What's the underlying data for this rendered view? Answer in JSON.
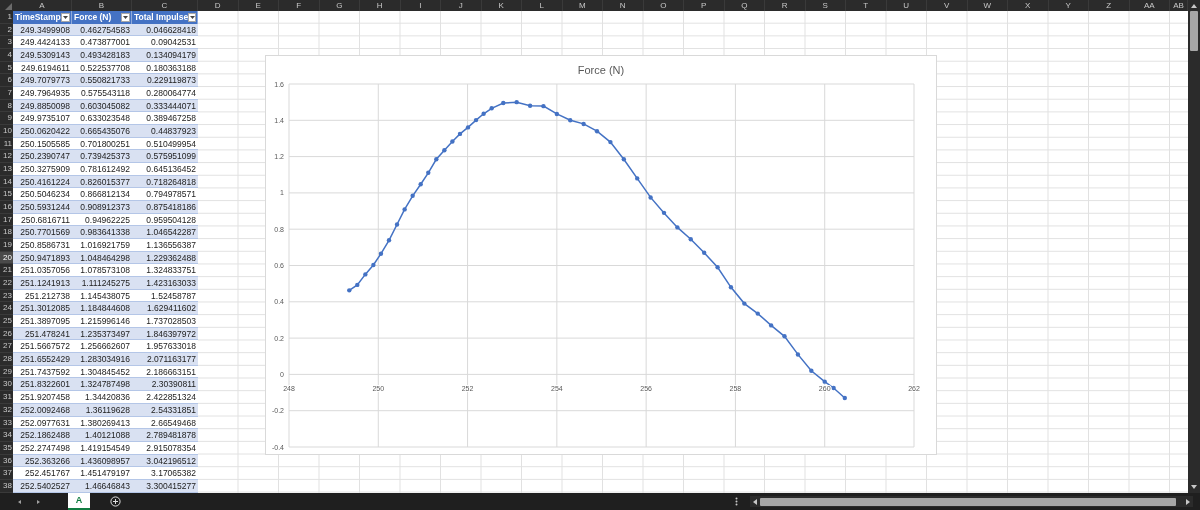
{
  "column_headers": [
    "A",
    "B",
    "C",
    "D",
    "E",
    "F",
    "G",
    "H",
    "I",
    "J",
    "K",
    "L",
    "M",
    "N",
    "O",
    "P",
    "Q",
    "R",
    "S",
    "T",
    "U",
    "V",
    "W",
    "X",
    "Y",
    "Z",
    "AA",
    "AB"
  ],
  "row_headers": [
    {
      "label": "1",
      "selected": false
    },
    {
      "label": "2",
      "selected": false
    },
    {
      "label": "3",
      "selected": false
    },
    {
      "label": "4",
      "selected": false
    },
    {
      "label": "5",
      "selected": false
    },
    {
      "label": "6",
      "selected": false
    },
    {
      "label": "7",
      "selected": false
    },
    {
      "label": "8",
      "selected": false
    },
    {
      "label": "9",
      "selected": false
    },
    {
      "label": "10",
      "selected": false
    },
    {
      "label": "11",
      "selected": false
    },
    {
      "label": "12",
      "selected": false
    },
    {
      "label": "13",
      "selected": false
    },
    {
      "label": "14",
      "selected": false
    },
    {
      "label": "15",
      "selected": false
    },
    {
      "label": "16",
      "selected": false
    },
    {
      "label": "17",
      "selected": false
    },
    {
      "label": "18",
      "selected": false
    },
    {
      "label": "19",
      "selected": false
    },
    {
      "label": "20",
      "selected": true
    },
    {
      "label": "21",
      "selected": false
    },
    {
      "label": "22",
      "selected": false
    },
    {
      "label": "23",
      "selected": false
    },
    {
      "label": "24",
      "selected": false
    },
    {
      "label": "25",
      "selected": false
    },
    {
      "label": "26",
      "selected": false
    },
    {
      "label": "27",
      "selected": false
    },
    {
      "label": "28",
      "selected": false
    },
    {
      "label": "29",
      "selected": false
    },
    {
      "label": "30",
      "selected": false
    },
    {
      "label": "31",
      "selected": false
    },
    {
      "label": "32",
      "selected": false
    },
    {
      "label": "33",
      "selected": false
    },
    {
      "label": "34",
      "selected": false
    },
    {
      "label": "35",
      "selected": false
    },
    {
      "label": "36",
      "selected": false
    },
    {
      "label": "37",
      "selected": false
    },
    {
      "label": "38",
      "selected": false
    }
  ],
  "table": {
    "columns": [
      "TimeStamp",
      "Force (N)",
      "Total Impulse"
    ],
    "rows": [
      [
        "249.3499908",
        "0.462754583",
        "0.046628418"
      ],
      [
        "249.4424133",
        "0.473877001",
        "0.09042531"
      ],
      [
        "249.5309143",
        "0.493428183",
        "0.134094179"
      ],
      [
        "249.6194611",
        "0.522537708",
        "0.180363188"
      ],
      [
        "249.7079773",
        "0.550821733",
        "0.229119873"
      ],
      [
        "249.7964935",
        "0.575543118",
        "0.280064774"
      ],
      [
        "249.8850098",
        "0.603045082",
        "0.333444071"
      ],
      [
        "249.9735107",
        "0.633023548",
        "0.389467258"
      ],
      [
        "250.0620422",
        "0.665435076",
        "0.44837923"
      ],
      [
        "250.1505585",
        "0.701800251",
        "0.510499954"
      ],
      [
        "250.2390747",
        "0.739425373",
        "0.575951099"
      ],
      [
        "250.3275909",
        "0.781612492",
        "0.645136452"
      ],
      [
        "250.4161224",
        "0.826015377",
        "0.718264818"
      ],
      [
        "250.5046234",
        "0.866812134",
        "0.794978571"
      ],
      [
        "250.5931244",
        "0.908912373",
        "0.875418186"
      ],
      [
        "250.6816711",
        "0.94962225",
        "0.959504128"
      ],
      [
        "250.7701569",
        "0.983641338",
        "1.046542287"
      ],
      [
        "250.8586731",
        "1.016921759",
        "1.136556387"
      ],
      [
        "250.9471893",
        "1.048464298",
        "1.229362488"
      ],
      [
        "251.0357056",
        "1.078573108",
        "1.324833751"
      ],
      [
        "251.1241913",
        "1.111245275",
        "1.423163033"
      ],
      [
        "251.212738",
        "1.145438075",
        "1.52458787"
      ],
      [
        "251.3012085",
        "1.184844608",
        "1.629411602"
      ],
      [
        "251.3897095",
        "1.215996146",
        "1.737028503"
      ],
      [
        "251.478241",
        "1.235373497",
        "1.846397972"
      ],
      [
        "251.5667572",
        "1.256662607",
        "1.957633018"
      ],
      [
        "251.6552429",
        "1.283034916",
        "2.071163177"
      ],
      [
        "251.7437592",
        "1.304845452",
        "2.186663151"
      ],
      [
        "251.8322601",
        "1.324787498",
        "2.30390811"
      ],
      [
        "251.9207458",
        "1.34420836",
        "2.422851324"
      ],
      [
        "252.0092468",
        "1.36119628",
        "2.54331851"
      ],
      [
        "252.0977631",
        "1.380269413",
        "2.66549468"
      ],
      [
        "252.1862488",
        "1.40121088",
        "2.789481878"
      ],
      [
        "252.2747498",
        "1.419154549",
        "2.915078354"
      ],
      [
        "252.363266",
        "1.436098957",
        "3.042196512"
      ],
      [
        "252.451767",
        "1.451479197",
        "3.17065382"
      ],
      [
        "252.5402527",
        "1.46646843",
        "3.300415277"
      ]
    ]
  },
  "chart": {
    "chart_data": {
      "type": "line",
      "title": "Force (N)",
      "x": [
        249.35,
        249.53,
        249.71,
        249.89,
        250.06,
        250.24,
        250.42,
        250.59,
        250.77,
        250.95,
        251.12,
        251.3,
        251.48,
        251.66,
        251.83,
        252.01,
        252.19,
        252.36,
        252.54,
        252.8,
        253.1,
        253.4,
        253.7,
        254.0,
        254.3,
        254.6,
        254.9,
        255.2,
        255.5,
        255.8,
        256.1,
        256.4,
        256.7,
        257.0,
        257.3,
        257.6,
        257.9,
        258.2,
        258.5,
        258.8,
        259.1,
        259.4,
        259.7,
        260.0,
        260.2,
        260.45
      ],
      "series": [
        {
          "color": "#4472c4",
          "values": [
            0.463,
            0.493,
            0.551,
            0.603,
            0.665,
            0.739,
            0.826,
            0.909,
            0.984,
            1.048,
            1.111,
            1.185,
            1.235,
            1.283,
            1.325,
            1.361,
            1.401,
            1.436,
            1.466,
            1.495,
            1.5,
            1.48,
            1.478,
            1.435,
            1.4,
            1.38,
            1.34,
            1.28,
            1.185,
            1.08,
            0.975,
            0.89,
            0.81,
            0.745,
            0.67,
            0.59,
            0.48,
            0.39,
            0.335,
            0.27,
            0.21,
            0.11,
            0.02,
            -0.04,
            -0.075,
            -0.13
          ]
        }
      ],
      "grid": true,
      "xlim": [
        248,
        262
      ],
      "ylim": [
        -0.4,
        1.6
      ],
      "xticks": [
        248,
        250,
        252,
        254,
        256,
        258,
        260,
        262
      ],
      "yticks": [
        {
          "value": -0.4,
          "label": "-0.4"
        },
        {
          "value": -0.2,
          "label": "-0.2"
        },
        {
          "value": 0,
          "label": "0"
        },
        {
          "value": 0.2,
          "label": "0.2"
        },
        {
          "value": 0.4,
          "label": "0.4"
        },
        {
          "value": 0.6,
          "label": "0.6"
        },
        {
          "value": 0.8,
          "label": "0.8"
        },
        {
          "value": 1,
          "label": "1"
        },
        {
          "value": 1.2,
          "label": "1.2"
        },
        {
          "value": 1.4,
          "label": "1.4"
        },
        {
          "value": 1.6,
          "label": "1.6"
        }
      ]
    }
  },
  "sheet_tabs": [
    {
      "label": "A",
      "selected": true
    }
  ]
}
